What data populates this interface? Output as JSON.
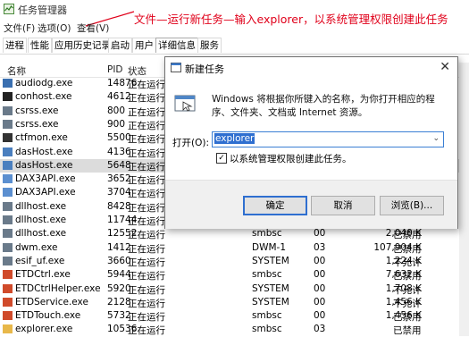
{
  "window": {
    "title": "任务管理器"
  },
  "annotation": "文件—运行新任务—输入explorer，以系统管理权限创建此任务",
  "menu": [
    "文件(F)",
    "选项(O)",
    "查看(V)"
  ],
  "tabs": [
    "进程",
    "性能",
    "应用历史记录",
    "启动",
    "用户",
    "详细信息",
    "服务"
  ],
  "columns": {
    "name": "名称",
    "pid": "PID",
    "status": "状态"
  },
  "rows": [
    {
      "name": "audiodg.exe",
      "pid": "14876",
      "status": "正在运行",
      "user": "",
      "cpu": "",
      "mem": "",
      "uac": ""
    },
    {
      "name": "conhost.exe",
      "pid": "4612",
      "status": "正在运行",
      "user": "",
      "cpu": "",
      "mem": "",
      "uac": ""
    },
    {
      "name": "csrss.exe",
      "pid": "800",
      "status": "正在运行",
      "user": "",
      "cpu": "",
      "mem": "",
      "uac": ""
    },
    {
      "name": "csrss.exe",
      "pid": "900",
      "status": "正在运行",
      "user": "",
      "cpu": "",
      "mem": "",
      "uac": ""
    },
    {
      "name": "ctfmon.exe",
      "pid": "5500",
      "status": "正在运行",
      "user": "",
      "cpu": "",
      "mem": "",
      "uac": ""
    },
    {
      "name": "dasHost.exe",
      "pid": "4136",
      "status": "正在运行",
      "user": "",
      "cpu": "",
      "mem": "",
      "uac": ""
    },
    {
      "name": "dasHost.exe",
      "pid": "5648",
      "status": "正在运行",
      "user": "",
      "cpu": "",
      "mem": "",
      "uac": ""
    },
    {
      "name": "DAX3API.exe",
      "pid": "3652",
      "status": "正在运行",
      "user": "",
      "cpu": "",
      "mem": "",
      "uac": ""
    },
    {
      "name": "DAX3API.exe",
      "pid": "3704",
      "status": "正在运行",
      "user": "",
      "cpu": "",
      "mem": "",
      "uac": ""
    },
    {
      "name": "dllhost.exe",
      "pid": "8428",
      "status": "正在运行",
      "user": "",
      "cpu": "",
      "mem": "",
      "uac": ""
    },
    {
      "name": "dllhost.exe",
      "pid": "11744",
      "status": "正在运行",
      "user": "",
      "cpu": "",
      "mem": "",
      "uac": ""
    },
    {
      "name": "dllhost.exe",
      "pid": "12552",
      "status": "正在运行",
      "user": "smbsc",
      "cpu": "00",
      "mem": "2,040 K",
      "uac": "已禁用"
    },
    {
      "name": "dwm.exe",
      "pid": "1412",
      "status": "正在运行",
      "user": "DWM-1",
      "cpu": "03",
      "mem": "107,904 K",
      "uac": "已禁用"
    },
    {
      "name": "esif_uf.exe",
      "pid": "3660",
      "status": "正在运行",
      "user": "SYSTEM",
      "cpu": "00",
      "mem": "1,224 K",
      "uac": "不允许"
    },
    {
      "name": "ETDCtrl.exe",
      "pid": "5944",
      "status": "正在运行",
      "user": "smbsc",
      "cpu": "00",
      "mem": "7,632 K",
      "uac": "已禁用"
    },
    {
      "name": "ETDCtrlHelper.exe",
      "pid": "5920",
      "status": "正在运行",
      "user": "SYSTEM",
      "cpu": "00",
      "mem": "1,708 K",
      "uac": "不允许"
    },
    {
      "name": "ETDService.exe",
      "pid": "2128",
      "status": "正在运行",
      "user": "SYSTEM",
      "cpu": "00",
      "mem": "1,456 K",
      "uac": "不允许"
    },
    {
      "name": "ETDTouch.exe",
      "pid": "5732",
      "status": "正在运行",
      "user": "smbsc",
      "cpu": "00",
      "mem": "1,456 K",
      "uac": "已禁用"
    },
    {
      "name": "explorer.exe",
      "pid": "10536",
      "status": "正在运行",
      "user": "smbsc",
      "cpu": "03",
      "mem": "",
      "uac": "已禁用"
    }
  ],
  "dialog": {
    "title": "新建任务",
    "description": "Windows 将根据你所键入的名称，为你打开相应的程序、文件夹、文档或 Internet 资源。",
    "open_label": "打开(O):",
    "input_value": "explorer",
    "checkbox_label": "以系统管理权限创建此任务。",
    "ok": "确定",
    "cancel": "取消",
    "browse": "浏览(B)..."
  }
}
